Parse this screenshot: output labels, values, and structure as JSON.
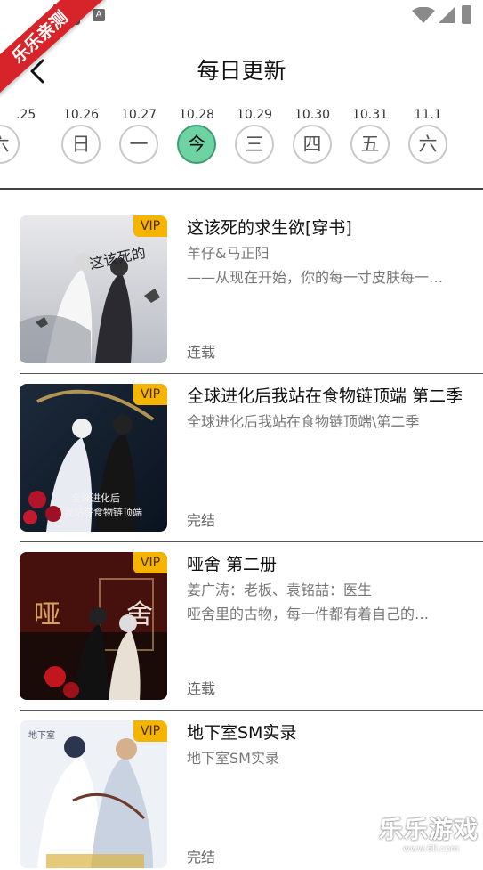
{
  "watermark": {
    "ribbon_text": "乐乐亲测",
    "brand_text": "乐乐游戏",
    "brand_url": "www.6ll.com"
  },
  "statusbar": {
    "a_icon": "A"
  },
  "header": {
    "title": "每日更新",
    "back_icon": "chevron-left-icon"
  },
  "days": [
    {
      "date": ".25",
      "label": "六",
      "active": false
    },
    {
      "date": "10.26",
      "label": "日",
      "active": false
    },
    {
      "date": "10.27",
      "label": "一",
      "active": false
    },
    {
      "date": "10.28",
      "label": "今",
      "active": true
    },
    {
      "date": "10.29",
      "label": "三",
      "active": false
    },
    {
      "date": "10.30",
      "label": "四",
      "active": false
    },
    {
      "date": "10.31",
      "label": "五",
      "active": false
    },
    {
      "date": "11.1",
      "label": "六",
      "active": false
    }
  ],
  "colors": {
    "active_day": "#6ed2a2",
    "vip_badge": "#f4b400"
  },
  "items": [
    {
      "badge": "VIP",
      "title": "这该死的求生欲[穿书]",
      "line1": "羊仔&马正阳",
      "line2": "——从现在开始，你的每一寸皮肤每一…",
      "status": "连载"
    },
    {
      "badge": "VIP",
      "title": "全球进化后我站在食物链顶端 第二季",
      "line1": "全球进化后我站在食物链顶端\\第二季",
      "status": "完结"
    },
    {
      "badge": "VIP",
      "title": "哑舍 第二册",
      "line1": "姜广涛：老板、袁铭喆：医生",
      "line2": "哑舍里的古物，每一件都有着自己的…",
      "status": "连载"
    },
    {
      "badge": "VIP",
      "title": "地下室SM实录",
      "line1": "地下室SM实录",
      "status": "完结"
    }
  ]
}
